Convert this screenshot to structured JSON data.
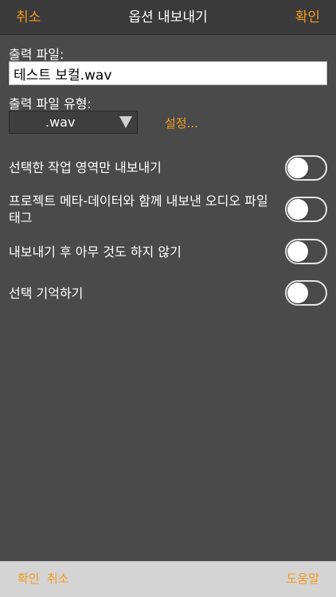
{
  "navbar": {
    "cancel_label": "취소",
    "title": "옵션 내보내기",
    "confirm_label": "확인"
  },
  "output_file": {
    "label": "출력 파일:",
    "value": "테스트 보컬.wav"
  },
  "output_type": {
    "label": "출력 파일 유형:",
    "selected": ".wav",
    "settings_label": "설정..."
  },
  "options": [
    {
      "label": "선택한 작업 영역만 내보내기",
      "enabled": false
    },
    {
      "label": "프로젝트 메타-데이터와 함께 내보낸 오디오 파일 태그",
      "enabled": false
    },
    {
      "label": "내보내기 후 아무 것도 하지 않기",
      "enabled": false
    },
    {
      "label": "선택 기억하기",
      "enabled": false
    }
  ],
  "footer": {
    "confirm_label": "확인",
    "cancel_label": "취소",
    "help_label": "도움말"
  },
  "colors": {
    "accent": "#f39a1e",
    "background": "#4a4a4a",
    "navbar": "#3a3a3a",
    "footer": "#d4d4d4"
  }
}
